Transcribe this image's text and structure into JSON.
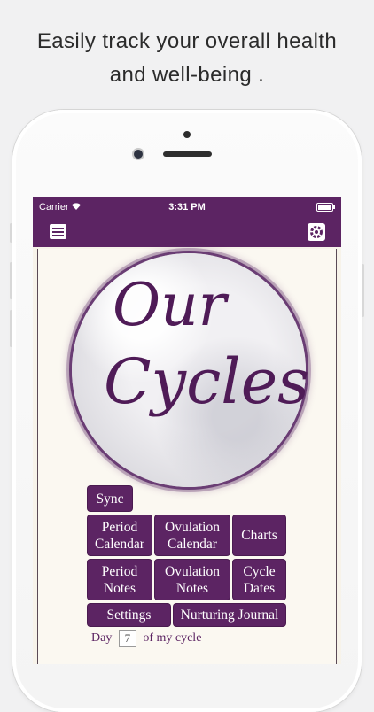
{
  "headline": {
    "line1": "Easily track your overall health",
    "line2": "and well-being ."
  },
  "status_bar": {
    "carrier": "Carrier",
    "time": "3:31 PM"
  },
  "logo": {
    "line1": "Our",
    "line2": "Cycles"
  },
  "buttons": {
    "sync": "Sync",
    "period_calendar": [
      "Period",
      "Calendar"
    ],
    "ovulation_calendar": [
      "Ovulation",
      "Calendar"
    ],
    "charts": "Charts",
    "period_notes": [
      "Period",
      "Notes"
    ],
    "ovulation_notes": [
      "Ovulation",
      "Notes"
    ],
    "cycle_dates": [
      "Cycle",
      "Dates"
    ],
    "settings": "Settings",
    "nurturing_journal": "Nurturing Journal"
  },
  "day_of_cycle": {
    "prefix": "Day",
    "value": "7",
    "suffix": "of my cycle"
  },
  "colors": {
    "brand_purple": "#5c2463",
    "paper": "#fbf8f1"
  },
  "icons": {
    "menu": "hamburger-menu-icon",
    "settings": "gear-icon"
  }
}
